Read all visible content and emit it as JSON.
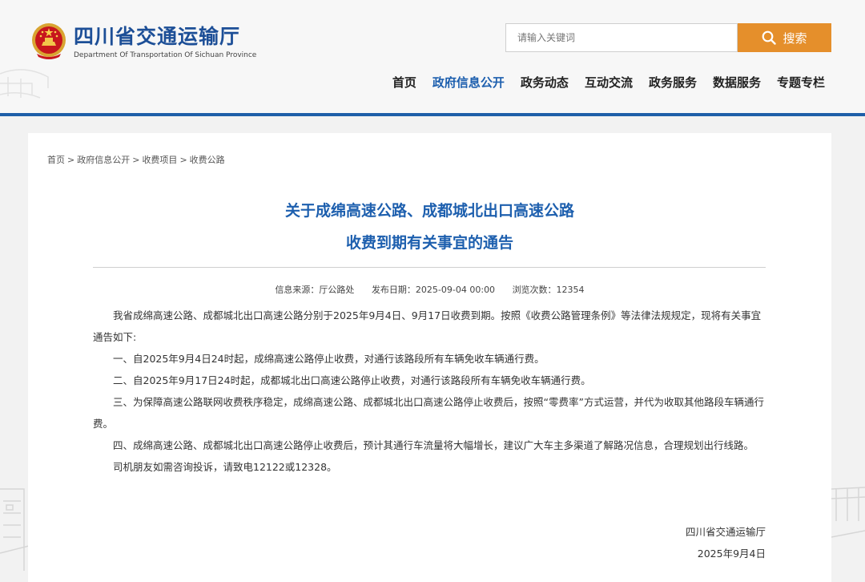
{
  "site": {
    "title": "四川省交通运输厅",
    "subtitle": "Department Of Transportation Of Sichuan Province",
    "search_placeholder": "请输入关键词",
    "search_button": "搜索"
  },
  "nav": [
    {
      "label": "首页",
      "active": false
    },
    {
      "label": "政府信息公开",
      "active": true
    },
    {
      "label": "政务动态",
      "active": false
    },
    {
      "label": "互动交流",
      "active": false
    },
    {
      "label": "政务服务",
      "active": false
    },
    {
      "label": "数据服务",
      "active": false
    },
    {
      "label": "专题专栏",
      "active": false
    }
  ],
  "breadcrumb": [
    "首页",
    "政府信息公开",
    "收费项目",
    "收费公路"
  ],
  "breadcrumb_sep": ">",
  "article": {
    "title_line1": "关于成绵高速公路、成都城北出口高速公路",
    "title_line2": "收费到期有关事宜的通告",
    "meta": {
      "source": "信息来源：厅公路处",
      "date": "发布日期：2025-09-04 00:00",
      "views": "浏览次数：12354"
    },
    "paragraphs": [
      "我省成绵高速公路、成都城北出口高速公路分别于2025年9月4日、9月17日收费到期。按照《收费公路管理条例》等法律法规规定，现将有关事宜通告如下:",
      "一、自2025年9月4日24时起，成绵高速公路停止收费，对通行该路段所有车辆免收车辆通行费。",
      "二、自2025年9月17日24时起，成都城北出口高速公路停止收费，对通行该路段所有车辆免收车辆通行费。",
      "三、为保障高速公路联网收费秩序稳定，成绵高速公路、成都城北出口高速公路停止收费后，按照“零费率”方式运营，并代为收取其他路段车辆通行费。",
      "四、成绵高速公路、成都城北出口高速公路停止收费后，预计其通行车流量将大幅增长，建议广大车主多渠道了解路况信息，合理规划出行线路。",
      "司机朋友如需咨询投诉，请致电12122或12328。"
    ],
    "sign_org": "四川省交通运输厅",
    "sign_date": "2025年9月4日"
  },
  "colors": {
    "brand_blue": "#1d5fae",
    "header_rule": "#1e5fa8",
    "search_orange": "#e58f2b"
  }
}
